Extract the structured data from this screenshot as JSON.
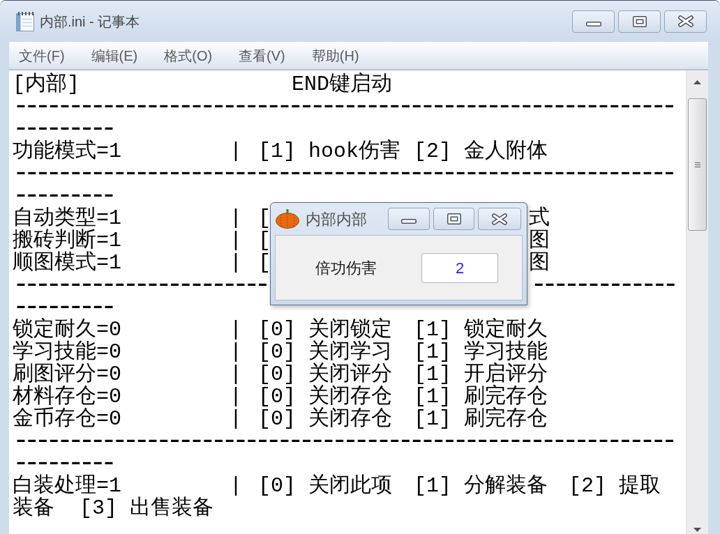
{
  "window": {
    "title": "内部.ini - 记事本"
  },
  "menu": [
    "文件(F)",
    "编辑(E)",
    "格式(O)",
    "查看(V)",
    "帮助(H)"
  ],
  "editor": {
    "lines": [
      {
        "kind": "header",
        "text": "[内部]",
        "note": "END键启动"
      },
      {
        "kind": "rule",
        "parts": [
          "------------------------------------------------------------"
        ]
      },
      {
        "kind": "rule",
        "parts": [
          "---------"
        ]
      },
      {
        "kind": "setting",
        "key": "功能模式=1",
        "separator": "|",
        "options": [
          "[1] hook伤害",
          "[2] 金人附体"
        ]
      },
      {
        "kind": "rule",
        "parts": [
          "------------------------------------------------------------"
        ]
      },
      {
        "kind": "rule",
        "parts": [
          "---------"
        ]
      },
      {
        "kind": "setting",
        "covered": true,
        "key": "自动类型=1",
        "separator": "|",
        "options": [
          "[",
          "式"
        ]
      },
      {
        "kind": "setting",
        "covered": true,
        "key": "搬砖判断=1",
        "separator": "|",
        "options": [
          "[",
          "图"
        ]
      },
      {
        "kind": "setting",
        "covered": true,
        "key": "顺图模式=1",
        "separator": "|",
        "options": [
          "[",
          "图"
        ]
      },
      {
        "kind": "rule",
        "covered": true,
        "parts": [
          "-----------------------",
          "-------------"
        ]
      },
      {
        "kind": "rule",
        "parts": [
          "---------"
        ]
      },
      {
        "kind": "setting",
        "key": "锁定耐久=0",
        "separator": "|",
        "options": [
          "[0] 关闭锁定",
          "[1] 锁定耐久"
        ]
      },
      {
        "kind": "setting",
        "key": "学习技能=0",
        "separator": "|",
        "options": [
          "[0] 关闭学习",
          "[1] 学习技能"
        ]
      },
      {
        "kind": "setting",
        "key": "刷图评分=0",
        "separator": "|",
        "options": [
          "[0] 关闭评分",
          "[1] 开启评分"
        ]
      },
      {
        "kind": "setting",
        "key": "材料存仓=0",
        "separator": "|",
        "options": [
          "[0] 关闭存仓",
          "[1] 刷完存仓"
        ]
      },
      {
        "kind": "setting",
        "key": "金币存仓=0",
        "separator": "|",
        "options": [
          "[0] 关闭存仓",
          "[1] 刷完存仓"
        ]
      },
      {
        "kind": "rule",
        "parts": [
          "------------------------------------------------------------"
        ]
      },
      {
        "kind": "rule",
        "parts": [
          "---------"
        ]
      },
      {
        "kind": "setting",
        "key": "白装处理=1",
        "separator": "|",
        "options": [
          "[0] 关闭此项",
          "[1] 分解装备",
          "[2] 提取"
        ]
      },
      {
        "kind": "text",
        "text": "装备  [3] 出售装备"
      }
    ]
  },
  "dialog": {
    "title": "内部内部",
    "field_label": "倍功伤害",
    "value": "2"
  }
}
